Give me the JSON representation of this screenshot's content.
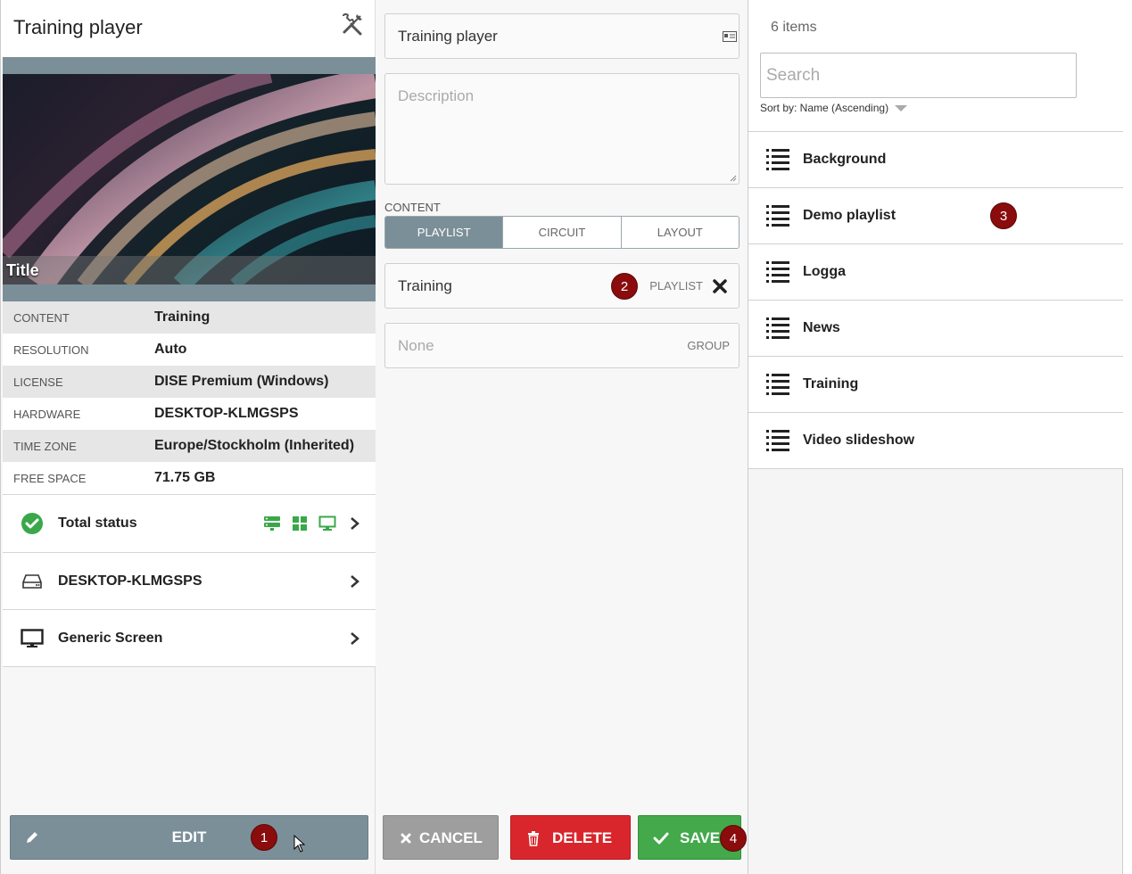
{
  "left_panel": {
    "title": "Training player",
    "preview_caption": "Title",
    "properties": [
      {
        "key": "CONTENT",
        "value": "Training"
      },
      {
        "key": "RESOLUTION",
        "value": "Auto"
      },
      {
        "key": "LICENSE",
        "value": "DISE Premium (Windows)"
      },
      {
        "key": "HARDWARE",
        "value": "DESKTOP-KLMGSPS"
      },
      {
        "key": "TIME ZONE",
        "value": "Europe/Stockholm (Inherited)"
      },
      {
        "key": "FREE SPACE",
        "value": "71.75 GB"
      }
    ],
    "status_rows": [
      {
        "label": "Total status",
        "icon": "check-circle-icon"
      },
      {
        "label": "DESKTOP-KLMGSPS",
        "icon": "hard-drive-icon"
      },
      {
        "label": "Generic Screen",
        "icon": "monitor-icon"
      }
    ],
    "edit_label": "EDIT",
    "marker": "1"
  },
  "middle_panel": {
    "name_value": "Training player",
    "description_placeholder": "Description",
    "content_label": "CONTENT",
    "tabs": [
      "PLAYLIST",
      "CIRCUIT",
      "LAYOUT"
    ],
    "active_tab": "PLAYLIST",
    "selected_content": {
      "name": "Training",
      "type": "PLAYLIST",
      "marker": "2"
    },
    "group": {
      "placeholder": "None",
      "type": "GROUP"
    },
    "buttons": {
      "cancel": "CANCEL",
      "delete": "DELETE",
      "save": "SAVE"
    },
    "save_marker": "4"
  },
  "right_panel": {
    "count": "6 items",
    "search_placeholder": "Search",
    "sort_label": "Sort by: Name (Ascending)",
    "items": [
      "Background",
      "Demo playlist",
      "Logga",
      "News",
      "Training",
      "Video slideshow"
    ],
    "marker": "3"
  },
  "colors": {
    "accent_slate": "#7b8f99",
    "delete_red": "#d9262c",
    "save_green": "#43a94b",
    "cancel_gray": "#9e9e9e",
    "marker_red": "#8a0c0c",
    "status_green": "#3aa84a"
  }
}
